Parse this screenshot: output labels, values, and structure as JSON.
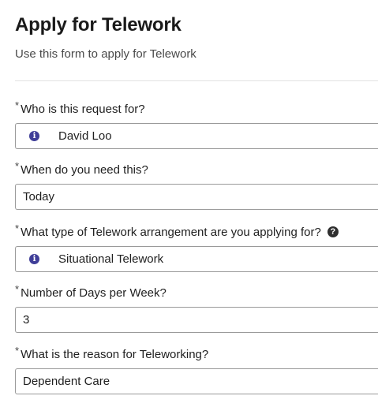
{
  "header": {
    "title": "Apply for Telework",
    "subtitle": "Use this form to apply for Telework"
  },
  "form": {
    "required_marker": "*",
    "help_icon": "question-circle-icon",
    "info_icon": "info-circle-icon",
    "accent_color": "#3f3e98",
    "fields": [
      {
        "label": "Who is this request for?",
        "value": "David Loo"
      },
      {
        "label": "When do you need this?",
        "value": "Today"
      },
      {
        "label": "What type of Telework arrangement are you applying for?",
        "value": "Situational Telework"
      },
      {
        "label": "Number of Days per Week?",
        "value": "3"
      },
      {
        "label": "What is the reason for Teleworking?",
        "value": "Dependent Care"
      }
    ]
  }
}
